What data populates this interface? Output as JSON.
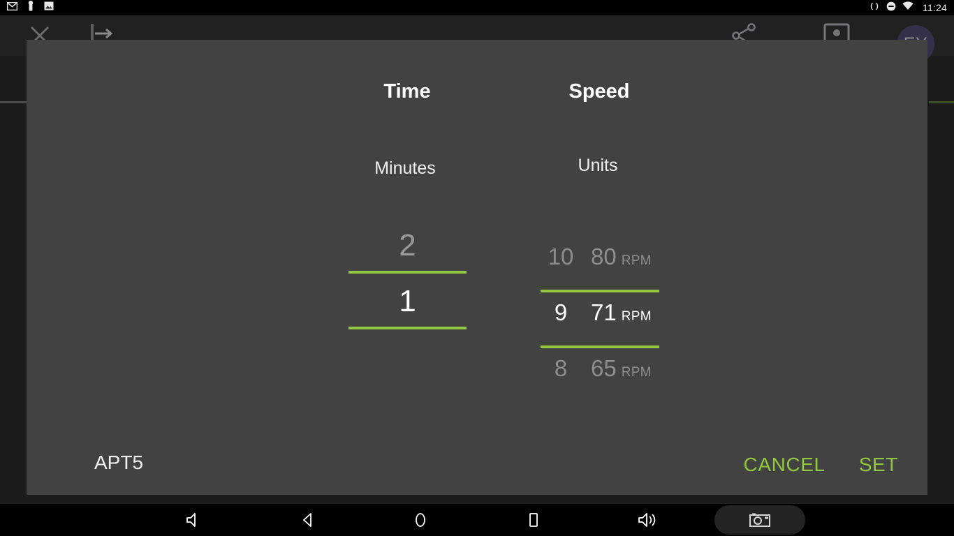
{
  "status_bar": {
    "icons": [
      "gmail-icon",
      "usb-icon",
      "screenshot-image-icon"
    ],
    "right_icons": [
      "vibrate-icon",
      "do-not-disturb-icon",
      "wifi-icon"
    ],
    "clock": "11:24"
  },
  "app_bar": {
    "close_icon": "close-icon",
    "exit_icon": "exit-arrow-icon",
    "share_icon": "share-icon",
    "contact_icon": "contact-card-icon",
    "avatar_initials": "EY",
    "avatar_color": "#353049"
  },
  "dialog": {
    "accent_color": "#93c83e",
    "background_color": "#424242",
    "headers": {
      "time": "Time",
      "speed": "Speed"
    },
    "sub_labels": {
      "minutes": "Minutes",
      "units": "Units"
    },
    "minutes_picker": {
      "label": "Minutes",
      "rows": [
        {
          "value": "2",
          "state": "dim"
        },
        {
          "value": "1",
          "state": "selected"
        }
      ]
    },
    "speed_picker": {
      "label": "Units",
      "rpm_label": "RPM",
      "rows": [
        {
          "unit": "10",
          "rpm": "80",
          "rpm_label": "RPM",
          "state": "dim"
        },
        {
          "unit": "9",
          "rpm": "71",
          "rpm_label": "RPM",
          "state": "selected"
        },
        {
          "unit": "8",
          "rpm": "65",
          "rpm_label": "RPM",
          "state": "dim"
        }
      ]
    },
    "device_label": "APT5",
    "actions": {
      "cancel": "CANCEL",
      "set": "SET"
    }
  },
  "nav_bar": {
    "buttons": [
      "volume-down-icon",
      "back-icon",
      "home-icon",
      "recents-icon",
      "volume-up-icon",
      "screenshot-camera-icon"
    ]
  }
}
